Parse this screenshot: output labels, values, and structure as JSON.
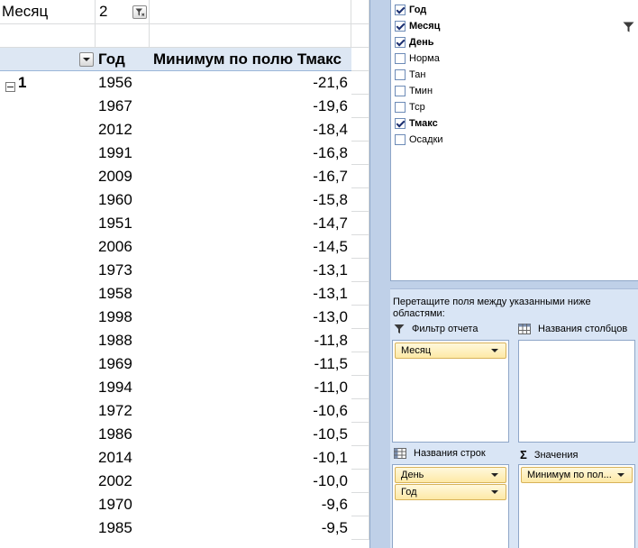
{
  "report_filter": {
    "label": "Месяц",
    "value": "2"
  },
  "pivot_header": {
    "year": "Год",
    "measure": "Минимум по полю Тмакс"
  },
  "group": {
    "label": "1"
  },
  "rows": [
    {
      "year": "1956",
      "value": "-21,6"
    },
    {
      "year": "1967",
      "value": "-19,6"
    },
    {
      "year": "2012",
      "value": "-18,4"
    },
    {
      "year": "1991",
      "value": "-16,8"
    },
    {
      "year": "2009",
      "value": "-16,7"
    },
    {
      "year": "1960",
      "value": "-15,8"
    },
    {
      "year": "1951",
      "value": "-14,7"
    },
    {
      "year": "2006",
      "value": "-14,5"
    },
    {
      "year": "1973",
      "value": "-13,1"
    },
    {
      "year": "1958",
      "value": "-13,1"
    },
    {
      "year": "1998",
      "value": "-13,0"
    },
    {
      "year": "1988",
      "value": "-11,8"
    },
    {
      "year": "1969",
      "value": "-11,5"
    },
    {
      "year": "1994",
      "value": "-11,0"
    },
    {
      "year": "1972",
      "value": "-10,6"
    },
    {
      "year": "1986",
      "value": "-10,5"
    },
    {
      "year": "2014",
      "value": "-10,1"
    },
    {
      "year": "2002",
      "value": "-10,0"
    },
    {
      "year": "1970",
      "value": "-9,6"
    },
    {
      "year": "1985",
      "value": "-9,5"
    }
  ],
  "field_list": {
    "fields": [
      {
        "name": "Год",
        "checked": true
      },
      {
        "name": "Месяц",
        "checked": true
      },
      {
        "name": "День",
        "checked": true
      },
      {
        "name": "Норма",
        "checked": false
      },
      {
        "name": "Тан",
        "checked": false
      },
      {
        "name": "Тмин",
        "checked": false
      },
      {
        "name": "Тср",
        "checked": false
      },
      {
        "name": "Тмакс",
        "checked": true
      },
      {
        "name": "Осадки",
        "checked": false
      }
    ]
  },
  "areas": {
    "instruction": "Перетащите поля между указанными ниже областями:",
    "report_filter": {
      "title": "Фильтр отчета",
      "items": [
        "Месяц"
      ]
    },
    "column_labels": {
      "title": "Названия столбцов",
      "items": []
    },
    "row_labels": {
      "title": "Названия строк",
      "items": [
        "День",
        "Год"
      ]
    },
    "values": {
      "title": "Значения",
      "items": [
        "Минимум по пол..."
      ]
    }
  },
  "colors": {
    "pane_bg": "#bfd0e8",
    "header_bg": "#dde7f3",
    "chip_bg": "#fde9a6",
    "checkmark": "#1b2f70"
  }
}
